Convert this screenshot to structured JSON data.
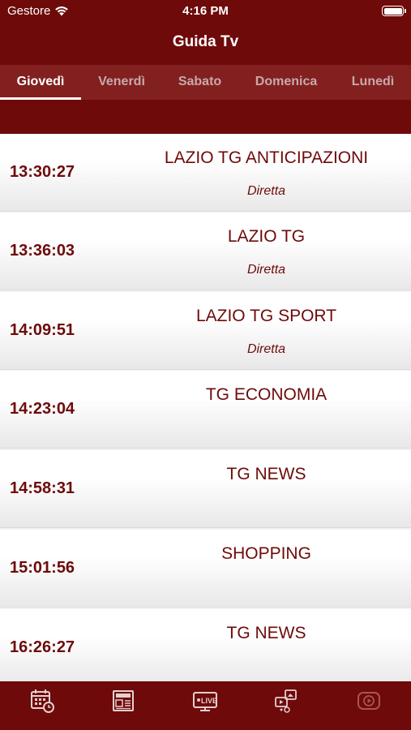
{
  "status_bar": {
    "carrier": "Gestore",
    "time": "4:16 PM"
  },
  "nav": {
    "title": "Guida Tv"
  },
  "day_tabs": [
    {
      "label": "Giovedì",
      "active": true
    },
    {
      "label": "Venerdì",
      "active": false
    },
    {
      "label": "Sabato",
      "active": false
    },
    {
      "label": "Domenica",
      "active": false
    },
    {
      "label": "Lunedì",
      "active": false
    }
  ],
  "schedule": [
    {
      "time": "13:30:27",
      "title": "LAZIO TG ANTICIPAZIONI",
      "status": "Diretta"
    },
    {
      "time": "13:36:03",
      "title": "LAZIO TG",
      "status": "Diretta"
    },
    {
      "time": "14:09:51",
      "title": "LAZIO TG SPORT",
      "status": "Diretta"
    },
    {
      "time": "14:23:04",
      "title": "TG ECONOMIA",
      "status": ""
    },
    {
      "time": "14:58:31",
      "title": "TG NEWS",
      "status": ""
    },
    {
      "time": "15:01:56",
      "title": "SHOPPING",
      "status": ""
    },
    {
      "time": "16:26:27",
      "title": "TG NEWS",
      "status": ""
    }
  ],
  "bottom_tabs": [
    {
      "icon": "calendar-clock-icon",
      "active": true
    },
    {
      "icon": "newspaper-icon",
      "active": true
    },
    {
      "icon": "live-tv-icon",
      "active": true
    },
    {
      "icon": "media-gallery-icon",
      "active": true
    },
    {
      "icon": "video-play-icon",
      "active": false
    }
  ],
  "colors": {
    "primary": "#6e0a0a",
    "tab_strip": "#822020",
    "text_dark_red": "#6e0a0a"
  }
}
